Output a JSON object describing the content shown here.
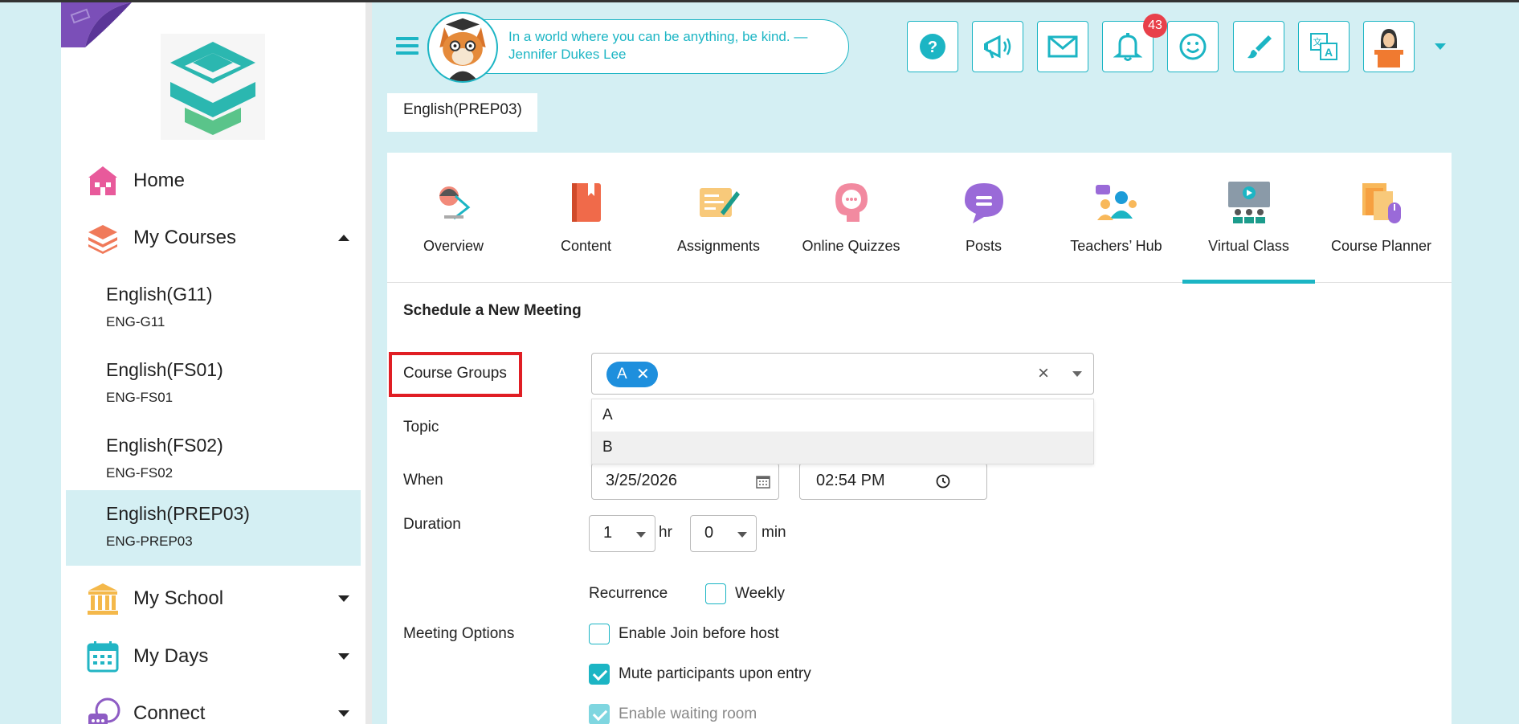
{
  "header": {
    "quote": "In a world where you can be anything, be kind. — Jennifer Dukes Lee",
    "notification_count": "43",
    "icons": [
      "help-icon",
      "megaphone-icon",
      "mail-icon",
      "bell-icon",
      "smiley-icon",
      "brush-icon",
      "translate-icon",
      "teacher-avatar-icon"
    ]
  },
  "sidebar": {
    "home": "Home",
    "my_courses": "My Courses",
    "courses": [
      {
        "name": "English(G11)",
        "code": "ENG-G11"
      },
      {
        "name": "English(FS01)",
        "code": "ENG-FS01"
      },
      {
        "name": "English(FS02)",
        "code": "ENG-FS02"
      },
      {
        "name": "English(PREP03)",
        "code": "ENG-PREP03"
      }
    ],
    "my_school": "My School",
    "my_days": "My Days",
    "connect": "Connect"
  },
  "course_tab": "English(PREP03)",
  "tabs": [
    {
      "label": "Overview",
      "icon": "overview-icon"
    },
    {
      "label": "Content",
      "icon": "book-icon"
    },
    {
      "label": "Assignments",
      "icon": "assignment-icon"
    },
    {
      "label": "Online Quizzes",
      "icon": "quiz-icon"
    },
    {
      "label": "Posts",
      "icon": "chat-icon"
    },
    {
      "label": "Teachers’ Hub",
      "icon": "teachers-icon"
    },
    {
      "label": "Virtual Class",
      "icon": "virtual-class-icon"
    },
    {
      "label": "Course Planner",
      "icon": "planner-icon"
    }
  ],
  "active_tab": "Virtual Class",
  "form": {
    "title": "Schedule a New Meeting",
    "course_groups_label": "Course Groups",
    "selected_group": "A",
    "clear": "×",
    "options": [
      "A",
      "B"
    ],
    "topic_label": "Topic",
    "when_label": "When",
    "date": "3/25/2026",
    "time": "02:54 PM",
    "duration_label": "Duration",
    "hours": "1",
    "hr": "hr",
    "minutes": "0",
    "min": "min",
    "recurrence_label": "Recurrence",
    "weekly": "Weekly",
    "meeting_options_label": "Meeting Options",
    "join_before_host": "Enable Join before host",
    "mute_on_entry": "Mute participants upon entry",
    "waiting_room": "Enable waiting room"
  },
  "colors": {
    "accent": "#1cb5c4",
    "background": "#d4eff3",
    "chip": "#1e8fdd",
    "highlight": "#e01e24",
    "badge": "#e8404a"
  }
}
